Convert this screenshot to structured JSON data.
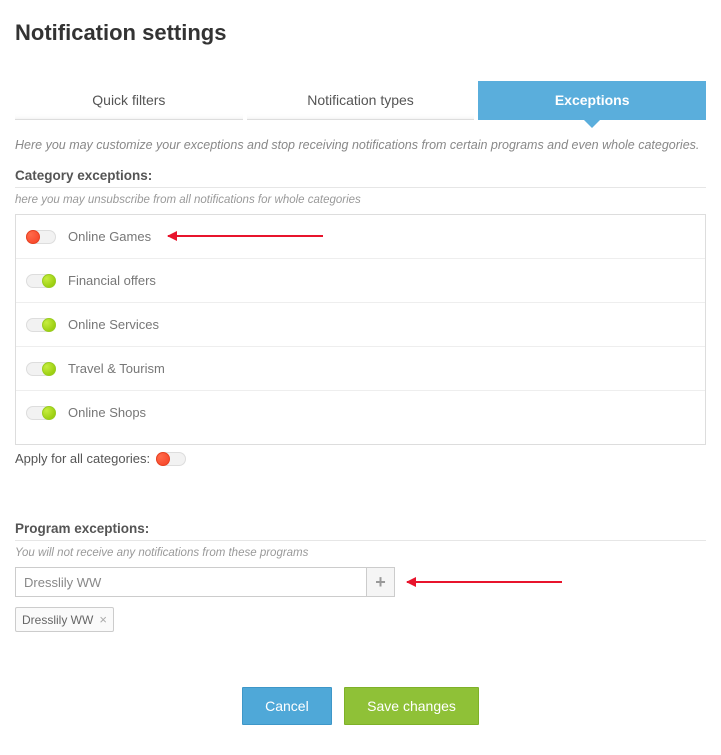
{
  "pageTitle": "Notification settings",
  "tabs": [
    {
      "label": "Quick filters",
      "active": false
    },
    {
      "label": "Notification types",
      "active": false
    },
    {
      "label": "Exceptions",
      "active": true
    }
  ],
  "description": "Here you may customize your exceptions and stop receiving notifications from certain programs and even whole categories.",
  "categorySection": {
    "title": "Category exceptions:",
    "sub": "here you may unsubscribe from all notifications for whole categories",
    "items": [
      {
        "label": "Online Games",
        "on": false
      },
      {
        "label": "Financial offers",
        "on": true
      },
      {
        "label": "Online Services",
        "on": true
      },
      {
        "label": "Travel & Tourism",
        "on": true
      },
      {
        "label": "Online Shops",
        "on": true
      }
    ],
    "applyAll": {
      "label": "Apply for all categories:",
      "on": false
    }
  },
  "programSection": {
    "title": "Program exceptions:",
    "sub": "You will not receive any notifications from these programs",
    "inputValue": "Dresslily WW",
    "tags": [
      {
        "label": "Dresslily WW"
      }
    ]
  },
  "buttons": {
    "cancel": "Cancel",
    "save": "Save changes"
  }
}
